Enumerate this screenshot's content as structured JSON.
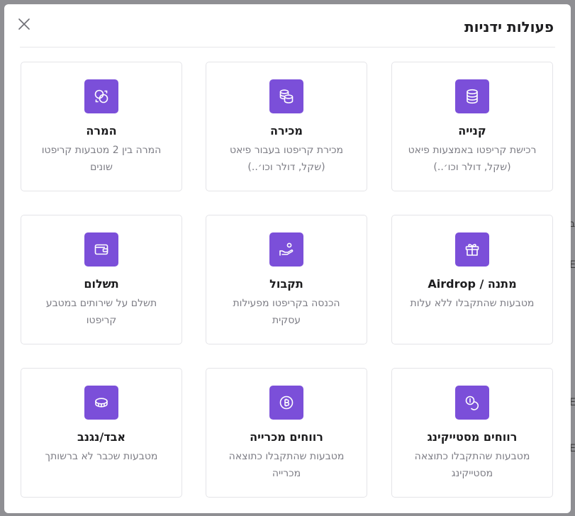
{
  "modal": {
    "title": "פעולות ידניות"
  },
  "actions": [
    {
      "id": "buy",
      "title": "קנייה",
      "description": "רכישת קריפטו באמצעות פיאט (שקל, דולר וכו׳..)",
      "icon": "coin-stack-icon"
    },
    {
      "id": "sell",
      "title": "מכירה",
      "description": "מכירת קריפטו בעבור פיאט (שקל, דולר וכו׳..)",
      "icon": "coins-icon"
    },
    {
      "id": "convert",
      "title": "המרה",
      "description": "המרה בין 2 מטבעות קריפטו שונים",
      "icon": "convert-icon"
    },
    {
      "id": "gift",
      "title": "מתנה / Airdrop",
      "description": "מטבעות שהתקבלו ללא עלות",
      "icon": "gift-icon"
    },
    {
      "id": "receive",
      "title": "תקבול",
      "description": "הכנסה בקריפטו מפעילות עסקית",
      "icon": "hand-coin-icon"
    },
    {
      "id": "payment",
      "title": "תשלום",
      "description": "תשלם על שירותים במטבע קריפטו",
      "icon": "wallet-icon"
    },
    {
      "id": "staking",
      "title": "רווחים מסטייקינג",
      "description": "מטבעות שהתקבלו כתוצאה מסטייקינג",
      "icon": "staking-coins-icon"
    },
    {
      "id": "mining",
      "title": "רווחים מכרייה",
      "description": "מטבעות שהתקבלו כתוצאה מכרייה",
      "icon": "bitcoin-icon"
    },
    {
      "id": "lost",
      "title": "אבד/נגנב",
      "description": "מטבעות שכבר לא ברשותך",
      "icon": "lost-coin-icon"
    }
  ],
  "colors": {
    "accent": "#7b4fd9",
    "border": "#e4e4e8",
    "muted_text": "#7c7c84"
  }
}
